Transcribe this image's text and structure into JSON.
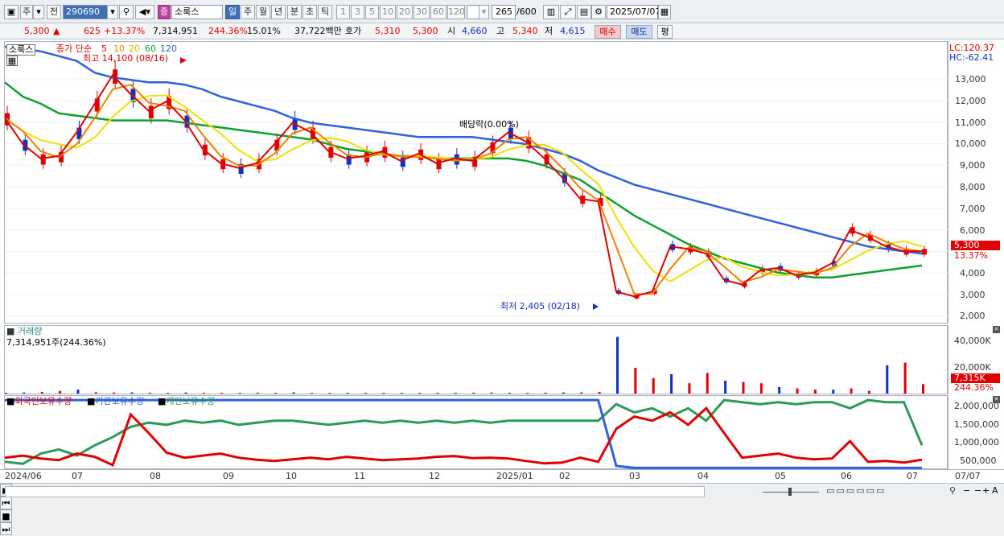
{
  "toolbar": {
    "type_label": "주",
    "prev_label": "전",
    "code": "290690",
    "market_label": "증",
    "stock_name": "소룩스",
    "periods": [
      "일",
      "주",
      "월",
      "년",
      "분",
      "초",
      "틱"
    ],
    "intervals": [
      "1",
      "3",
      "5",
      "10",
      "20",
      "30",
      "60",
      "120"
    ],
    "count": "265",
    "count_total": "/600",
    "date": "2025/07/07"
  },
  "quote": {
    "price": "5,300",
    "arrow": "▲",
    "change": "625",
    "change_pct": "+13.37%",
    "volume": "7,314,951",
    "vol_ratio": "244.36%",
    "turnover": "15.01%",
    "amount": "37,722백만",
    "ask_label": "호가",
    "ask1": "5,310",
    "ask2": "5,300",
    "open_label": "시",
    "open": "4,660",
    "high_label": "고",
    "high": "5,340",
    "low_label": "저",
    "low": "4,615",
    "buy_label": "매수",
    "sell_label": "매도",
    "eval_label": "평"
  },
  "price_panel": {
    "name": "소룩스",
    "ma_title": "종가 단순",
    "ma_periods": [
      "5",
      "10",
      "20",
      "60",
      "120"
    ],
    "ma_colors": [
      "#e00000",
      "#f08000",
      "#f0e000",
      "#10a030",
      "#3060e0"
    ],
    "high_note": "최고 14,100 (08/16)",
    "low_note": "최저 2,405 (02/18)",
    "dividend_note": "배당락(0.00%)",
    "lc": "LC:120.37",
    "hc": "HC:-62.41",
    "y_ticks": [
      "13,000",
      "12,000",
      "11,000",
      "10,000",
      "9,000",
      "8,000",
      "7,000",
      "6,000",
      "5,000",
      "4,000",
      "3,000",
      "2,000"
    ],
    "last_price": "5,300",
    "last_pct": "13.37%"
  },
  "volume_panel": {
    "title": "거래량",
    "value": "7,314,951주(244.36%)",
    "y_ticks": [
      "40,000K",
      "20,000K"
    ],
    "last_vol": "7,315K",
    "last_pct": "244.36%"
  },
  "holdings_panel": {
    "legend": [
      "외국인보유수량",
      "기관보유수량",
      "개인보유수량"
    ],
    "colors": [
      "#e00000",
      "#3060e0",
      "#2e9a5a"
    ],
    "y_ticks": [
      "2,000,000",
      "1,500,000",
      "1,000,000",
      "500,000"
    ]
  },
  "x_axis": {
    "labels": [
      "2024/06",
      "07",
      "08",
      "09",
      "10",
      "11",
      "12",
      "2025/01",
      "02",
      "03",
      "04",
      "05",
      "06",
      "07",
      "07/07"
    ]
  },
  "chart_data": [
    {
      "type": "line",
      "title": "",
      "series_note": "price & moving averages (approx. by date index, 0..264)",
      "series": [
        {
          "name": "5",
          "values": [
            10300,
            9200,
            8600,
            8700,
            9700,
            10900,
            12100,
            11300,
            10600,
            11000,
            10200,
            9000,
            8400,
            8200,
            8400,
            9200,
            10100,
            9700,
            8900,
            8600,
            8700,
            8900,
            8500,
            8800,
            8400,
            8600,
            8500,
            9100,
            9700,
            9300,
            8600,
            7800,
            6900,
            6800,
            3000,
            2800,
            3000,
            4900,
            4800,
            4600,
            3500,
            3300,
            3900,
            4000,
            3700,
            3800,
            4200,
            5600,
            5300,
            4900,
            4700,
            4700
          ]
        },
        {
          "name": "120",
          "values": [
            13300,
            13200,
            13100,
            12900,
            12700,
            12200,
            12000,
            11900,
            11800,
            11800,
            11700,
            11500,
            11200,
            11000,
            10800,
            10600,
            10300,
            10100,
            10000,
            9900,
            9800,
            9700,
            9600,
            9500,
            9500,
            9500,
            9500,
            9400,
            9300,
            9200,
            9000,
            8800,
            8500,
            8100,
            7800,
            7500,
            7300,
            7100,
            6900,
            6700,
            6500,
            6300,
            6100,
            5900,
            5700,
            5500,
            5300,
            5100,
            4900,
            4800,
            4700,
            4600
          ]
        },
        {
          "name": "60",
          "values": [
            11800,
            11200,
            10900,
            10500,
            10400,
            10300,
            10200,
            10200,
            10200,
            10200,
            10100,
            10000,
            9900,
            9800,
            9700,
            9600,
            9500,
            9400,
            9200,
            9000,
            8900,
            8800,
            8700,
            8700,
            8600,
            8600,
            8600,
            8600,
            8600,
            8500,
            8300,
            8000,
            7700,
            7200,
            6700,
            6200,
            5800,
            5400,
            5000,
            4700,
            4400,
            4200,
            4000,
            3800,
            3700,
            3600,
            3600,
            3700,
            3800,
            3900,
            4000,
            4100
          ]
        }
      ],
      "ylim": [
        2000,
        13500
      ]
    },
    {
      "type": "bar",
      "title": "",
      "series": [
        {
          "name": "거래량",
          "values": [
            0.6,
            0.8,
            1.2,
            2.0,
            3.0,
            1.0,
            0.8,
            0.9,
            0.7,
            0.6,
            0.8,
            0.5,
            0.6,
            0.5,
            0.7,
            0.6,
            0.9,
            0.5,
            0.5,
            0.6,
            0.5,
            0.6,
            0.5,
            0.5,
            0.6,
            0.6,
            0.7,
            0.8,
            0.6,
            0.5,
            0.7,
            0.8,
            0.9,
            1.2,
            44,
            20,
            12,
            15,
            8,
            16,
            10,
            9,
            8,
            5,
            4,
            3,
            3,
            4,
            2,
            22,
            24,
            7.3
          ]
        }
      ],
      "ylim": [
        0,
        45000
      ]
    },
    {
      "type": "line",
      "title": "",
      "series": [
        {
          "name": "외국인보유수량",
          "values": [
            600000,
            650000,
            580000,
            540000,
            700000,
            620000,
            420000,
            1650000,
            1200000,
            720000,
            600000,
            650000,
            700000,
            600000,
            550000,
            520000,
            560000,
            600000,
            560000,
            620000,
            580000,
            540000,
            560000,
            580000,
            620000,
            640000,
            590000,
            600000,
            580000,
            520000,
            460000,
            480000,
            600000,
            500000,
            1300000,
            1600000,
            1500000,
            1700000,
            1400000,
            1800000,
            1200000,
            600000,
            650000,
            700000,
            600000,
            560000,
            580000,
            1000000,
            500000,
            520000,
            480000,
            550000
          ]
        },
        {
          "name": "기관보유수량",
          "values": [
            2000000,
            2000000,
            2000000,
            2000000,
            2000000,
            2000000,
            2000000,
            2000000,
            2000000,
            2000000,
            2000000,
            2000000,
            2000000,
            2000000,
            2000000,
            2000000,
            2000000,
            2000000,
            2000000,
            2000000,
            2000000,
            2000000,
            2000000,
            2000000,
            2000000,
            2000000,
            2000000,
            2000000,
            2000000,
            2000000,
            2000000,
            2000000,
            2000000,
            2000000,
            400000,
            350000,
            350000,
            350000,
            350000,
            350000,
            350000,
            350000,
            350000,
            350000,
            350000,
            350000,
            350000,
            350000,
            350000,
            350000,
            350000,
            350000
          ]
        },
        {
          "name": "개인보유수량",
          "values": [
            500000,
            450000,
            700000,
            800000,
            650000,
            900000,
            1100000,
            1350000,
            1450000,
            1400000,
            1500000,
            1450000,
            1500000,
            1400000,
            1450000,
            1500000,
            1500000,
            1450000,
            1400000,
            1450000,
            1500000,
            1450000,
            1500000,
            1450000,
            1500000,
            1450000,
            1500000,
            1450000,
            1500000,
            1500000,
            1500000,
            1500000,
            1500000,
            1500000,
            1900000,
            1700000,
            1800000,
            1600000,
            1800000,
            1500000,
            2000000,
            1950000,
            1900000,
            1950000,
            1900000,
            1950000,
            1950000,
            1800000,
            2000000,
            1950000,
            1950000,
            900000
          ]
        }
      ],
      "ylim": [
        300000,
        2100000
      ]
    }
  ]
}
